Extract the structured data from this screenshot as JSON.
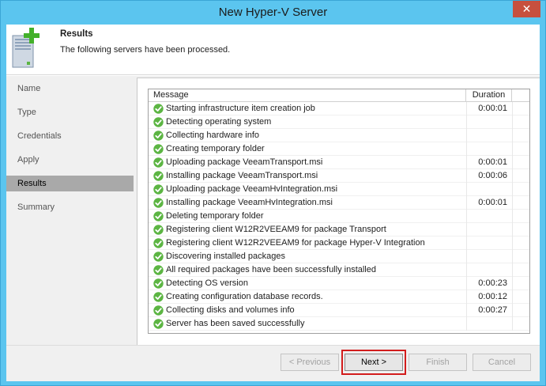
{
  "window": {
    "title": "New Hyper-V Server",
    "close_glyph": "✕"
  },
  "header": {
    "title": "Results",
    "subtitle": "The following servers have been processed.",
    "icon": "server-add-icon"
  },
  "sidebar": {
    "items": [
      {
        "label": "Name",
        "active": false
      },
      {
        "label": "Type",
        "active": false
      },
      {
        "label": "Credentials",
        "active": false
      },
      {
        "label": "Apply",
        "active": false
      },
      {
        "label": "Results",
        "active": true
      },
      {
        "label": "Summary",
        "active": false
      }
    ]
  },
  "grid": {
    "columns": {
      "message": "Message",
      "duration": "Duration"
    },
    "rows": [
      {
        "message": "Starting infrastructure item creation job",
        "duration": "0:00:01"
      },
      {
        "message": "Detecting operating system",
        "duration": ""
      },
      {
        "message": "Collecting hardware info",
        "duration": ""
      },
      {
        "message": "Creating temporary folder",
        "duration": ""
      },
      {
        "message": "Uploading package VeeamTransport.msi",
        "duration": "0:00:01"
      },
      {
        "message": "Installing package VeeamTransport.msi",
        "duration": "0:00:06"
      },
      {
        "message": "Uploading package VeeamHvIntegration.msi",
        "duration": ""
      },
      {
        "message": "Installing package VeeamHvIntegration.msi",
        "duration": "0:00:01"
      },
      {
        "message": "Deleting temporary folder",
        "duration": ""
      },
      {
        "message": "Registering client W12R2VEEAM9 for package Transport",
        "duration": ""
      },
      {
        "message": "Registering client W12R2VEEAM9 for package Hyper-V Integration",
        "duration": ""
      },
      {
        "message": "Discovering installed packages",
        "duration": ""
      },
      {
        "message": "All required packages have been successfully installed",
        "duration": ""
      },
      {
        "message": "Detecting OS version",
        "duration": "0:00:23"
      },
      {
        "message": "Creating configuration database records.",
        "duration": "0:00:12"
      },
      {
        "message": "Collecting disks and volumes info",
        "duration": "0:00:27"
      },
      {
        "message": "Server has been saved successfully",
        "duration": ""
      }
    ]
  },
  "footer": {
    "previous_label": "< Previous",
    "next_label": "Next >",
    "finish_label": "Finish",
    "cancel_label": "Cancel"
  },
  "colors": {
    "title_bar": "#5bc5ef",
    "success_green": "#5cb543",
    "highlight_red": "#d21c1c",
    "active_sidebar": "#a9a9a9"
  }
}
